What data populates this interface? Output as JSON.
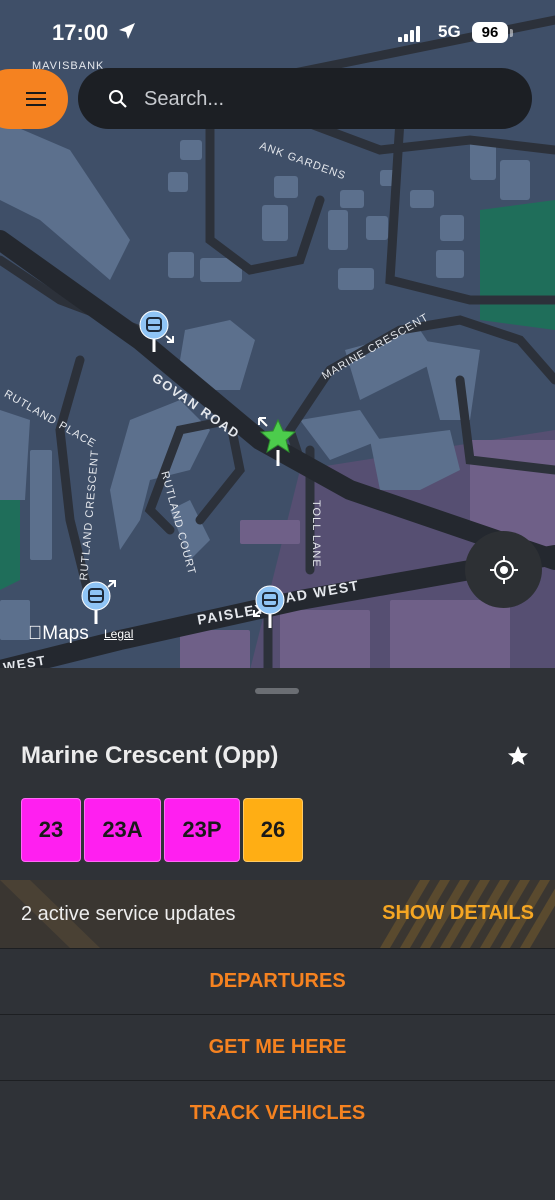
{
  "status_bar": {
    "time": "17:00",
    "network": "5G",
    "battery": "96"
  },
  "search": {
    "placeholder": "Search..."
  },
  "map": {
    "streets": [
      "MAVISBANK",
      "ANK GARDENS",
      "GOVAN ROAD",
      "MARINE CRESCENT",
      "RUTLAND PLACE",
      "RUTLAND CRESCENT",
      "RUTLAND COURT",
      "TOLL LANE",
      "PAISLEY",
      "AD WEST",
      "WEST"
    ],
    "attribution": {
      "maps": "Maps",
      "legal": "Legal"
    }
  },
  "stop": {
    "name": "Marine Crescent (Opp)",
    "routes": [
      {
        "label": "23",
        "color": "#ff1ff0"
      },
      {
        "label": "23A",
        "color": "#ff1ff0"
      },
      {
        "label": "23P",
        "color": "#ff1ff0"
      },
      {
        "label": "26",
        "color": "#ffae14"
      }
    ]
  },
  "updates": {
    "text": "2 active service updates",
    "action": "SHOW DETAILS"
  },
  "actions": {
    "departures": "DEPARTURES",
    "get_me_here": "GET ME HERE",
    "track_vehicles": "TRACK VEHICLES"
  },
  "colors": {
    "accent": "#f58220",
    "map_bg": "#3f4f68",
    "green": "#4ccc4c"
  }
}
